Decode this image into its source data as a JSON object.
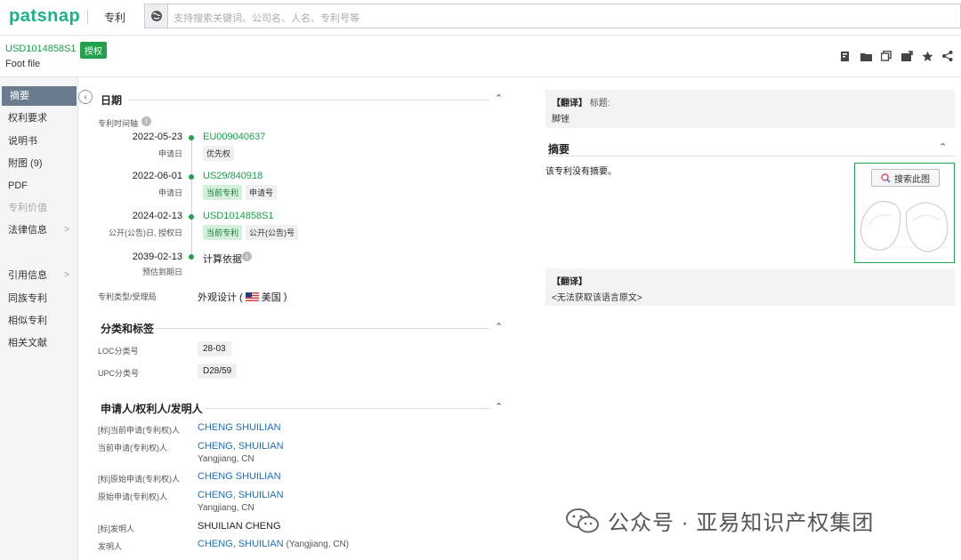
{
  "app": {
    "logo": "patsnap",
    "section": "专利",
    "search_placeholder": "支持搜索关键词、公司名、人名、专利号等"
  },
  "header": {
    "patent_number": "USD1014858S1",
    "status_badge": "授权",
    "title": "Foot file"
  },
  "header_icons": [
    "bookmark-icon",
    "folder-icon",
    "copy-icon",
    "share-out-icon",
    "star-icon",
    "share-icon"
  ],
  "sidebar": {
    "items": [
      {
        "label": "摘要",
        "active": true
      },
      {
        "label": "权利要求"
      },
      {
        "label": "说明书"
      },
      {
        "label": "附图 (9)"
      },
      {
        "label": "PDF"
      },
      {
        "label": "专利价值",
        "disabled": true
      },
      {
        "label": "法律信息",
        "chevron": true
      },
      {
        "label": "引用信息",
        "chevron": true
      },
      {
        "label": "同族专利"
      },
      {
        "label": "相似专利"
      },
      {
        "label": "相关文献"
      }
    ]
  },
  "dates": {
    "heading": "日期",
    "timeline_label": "专利时间轴",
    "events": [
      {
        "date": "2022-05-23",
        "sub": "申请日",
        "link": "EU009040637",
        "tags": [
          "优先权"
        ]
      },
      {
        "date": "2022-06-01",
        "sub": "申请日",
        "link": "US29/840918",
        "tags": [
          "当前专利",
          "申请号"
        ]
      },
      {
        "date": "2024-02-13",
        "sub": "公开(公告)日, 授权日",
        "link": "USD1014858S1",
        "tags": [
          "当前专利",
          "公开(公告)号"
        ]
      },
      {
        "date": "2039-02-13",
        "sub": "预估到期日",
        "text": "计算依据"
      }
    ],
    "type_label": "专利类型/受理局",
    "type_value": "外观设计 (",
    "country": "美国",
    "type_close": ")"
  },
  "classification": {
    "heading": "分类和标签",
    "loc_label": "LOC分类号",
    "loc_value": "28-03",
    "upc_label": "UPC分类号",
    "upc_value": "D28/59"
  },
  "parties": {
    "heading": "申请人/权利人/发明人",
    "rows": [
      {
        "label": "[标]当前申请(专利权)人",
        "name": "CHENG SHUILIAN"
      },
      {
        "label": "当前申请(专利权)人",
        "name": "CHENG, SHUILIAN",
        "location": "Yangjiang, CN"
      },
      {
        "label": "[标]原始申请(专利权)人",
        "name": "CHENG SHUILIAN"
      },
      {
        "label": "原始申请(专利权)人",
        "name": "CHENG, SHUILIAN",
        "location": "Yangjiang, CN"
      },
      {
        "label": "[标]发明人",
        "name": "SHUILIAN CHENG"
      },
      {
        "label": "发明人",
        "name": "CHENG, SHUILIAN",
        "suffix": "(Yangjiang, CN)"
      }
    ]
  },
  "right": {
    "title_translate_label": "【翻译】",
    "title_translate_key": "标题:",
    "title_translate_value": "脚锉",
    "abstract_heading": "摘要",
    "abstract_text": "该专利没有摘要。",
    "image_search_button": "搜索此图",
    "bottom_translate_label": "【翻译】",
    "bottom_translate_text": "<无法获取该语言原文>"
  },
  "watermark": {
    "text": "公众号 · 亚易知识产权集团"
  },
  "colors": {
    "brand": "#19b38a",
    "green": "#22a04b",
    "link": "#1d6fc4",
    "sidebar_active": "#6b7b8e"
  }
}
